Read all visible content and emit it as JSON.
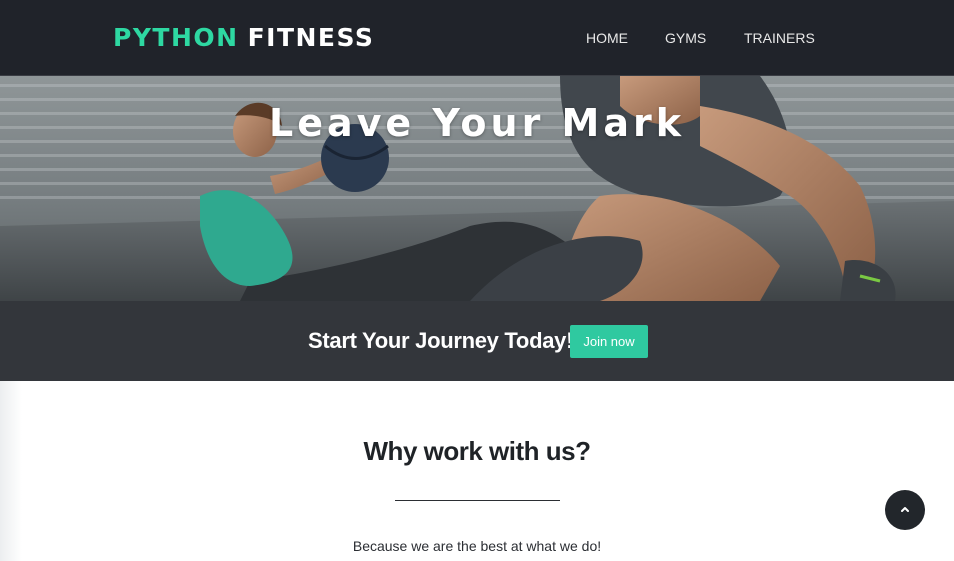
{
  "brand": {
    "part1": "PYTHON",
    "part2": "FITNESS",
    "accent_color": "#2ed8a2"
  },
  "nav": {
    "items": [
      {
        "label": "HOME"
      },
      {
        "label": "GYMS"
      },
      {
        "label": "TRAINERS"
      }
    ]
  },
  "hero": {
    "title": "Leave Your Mark"
  },
  "cta": {
    "text": "Start Your Journey Today!",
    "button_label": "Join now",
    "button_color": "#2fc9a0"
  },
  "section": {
    "title": "Why work with us?",
    "subtitle": "Because we are the best at what we do!"
  },
  "scroll_top": {
    "icon": "chevron-up-icon"
  }
}
